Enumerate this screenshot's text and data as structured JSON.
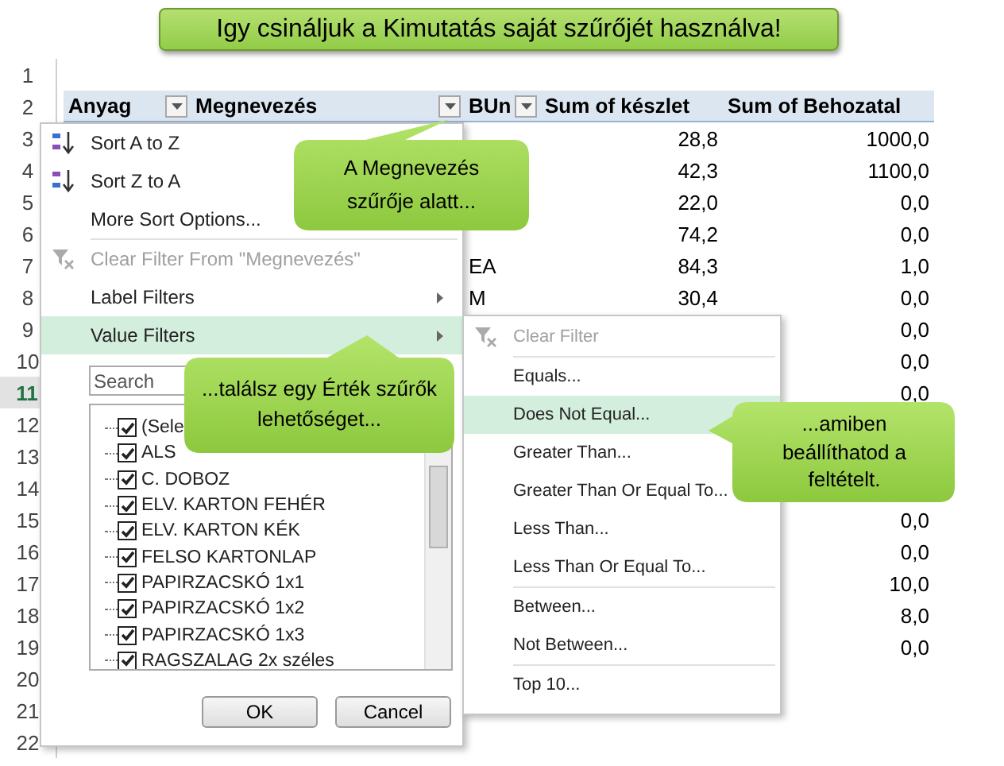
{
  "banner": {
    "text": "Igy csináljuk a Kimutatás saját szűrőjét használva!"
  },
  "sheet": {
    "row_numbers": [
      {
        "label": "1",
        "selected": false
      },
      {
        "label": "2",
        "selected": false
      },
      {
        "label": "3",
        "selected": false
      },
      {
        "label": "4",
        "selected": false
      },
      {
        "label": "5",
        "selected": false
      },
      {
        "label": "6",
        "selected": false
      },
      {
        "label": "7",
        "selected": false
      },
      {
        "label": "8",
        "selected": false
      },
      {
        "label": "9",
        "selected": false
      },
      {
        "label": "10",
        "selected": false
      },
      {
        "label": "11",
        "selected": true
      },
      {
        "label": "12",
        "selected": false
      },
      {
        "label": "13",
        "selected": false
      },
      {
        "label": "14",
        "selected": false
      },
      {
        "label": "15",
        "selected": false
      },
      {
        "label": "16",
        "selected": false
      },
      {
        "label": "17",
        "selected": false
      },
      {
        "label": "18",
        "selected": false
      },
      {
        "label": "19",
        "selected": false
      },
      {
        "label": "20",
        "selected": false
      },
      {
        "label": "21",
        "selected": false
      },
      {
        "label": "22",
        "selected": false
      }
    ],
    "columns": [
      {
        "label": "Anyag",
        "filter_button": true
      },
      {
        "label": "Megnevezés",
        "filter_button": true
      },
      {
        "label": "BUn",
        "filter_button": true
      },
      {
        "label": "Sum of készlet",
        "filter_button": false
      },
      {
        "label": "Sum of Behozatal",
        "filter_button": false
      }
    ],
    "rows": [
      {
        "keszlet": "28,8",
        "behozatal": "1000,0"
      },
      {
        "keszlet": "42,3",
        "behozatal": "1100,0"
      },
      {
        "keszlet": "22,0",
        "behozatal": "0,0"
      },
      {
        "keszlet": "74,2",
        "behozatal": "0,0"
      },
      {
        "bun": "EA",
        "keszlet": "84,3",
        "behozatal": "1,0"
      },
      {
        "bun": "M",
        "keszlet": "30,4",
        "behozatal": "0,0"
      },
      {
        "behozatal": "0,0"
      },
      {
        "behozatal": "0,0"
      },
      {
        "behozatal": "0,0"
      },
      {},
      {},
      {},
      {
        "behozatal": "0,0"
      },
      {
        "behozatal": "0,0"
      },
      {
        "behozatal": "10,0"
      },
      {
        "behozatal": "8,0"
      },
      {
        "behozatal": "0,0"
      }
    ]
  },
  "filter_menu": {
    "groups": [
      [
        {
          "kind": "sort_asc",
          "label": "Sort A to Z",
          "disabled": false,
          "selected": false
        },
        {
          "kind": "sort_desc",
          "label": "Sort Z to A",
          "disabled": false,
          "selected": false
        },
        {
          "kind": "item",
          "label": "More Sort Options...",
          "disabled": false,
          "selected": false
        }
      ],
      [
        {
          "kind": "clear",
          "label": "Clear Filter From \"Megnevezés\"",
          "disabled": true,
          "selected": false
        },
        {
          "kind": "submenu",
          "label": "Label Filters",
          "disabled": false,
          "selected": false
        },
        {
          "kind": "submenu",
          "label": "Value Filters",
          "disabled": false,
          "selected": true
        }
      ]
    ],
    "search": {
      "placeholder": "Search"
    },
    "checklist": [
      {
        "label": "(Sele",
        "checked": true
      },
      {
        "label": "ALS",
        "checked": true
      },
      {
        "label": "C. DOBOZ",
        "checked": true
      },
      {
        "label": "ELV. KARTON FEHÉR",
        "checked": true
      },
      {
        "label": "ELV. KARTON KÉK",
        "checked": true
      },
      {
        "label": "FELSO KARTONLAP",
        "checked": true
      },
      {
        "label": "PAPIRZACSKÓ 1x1",
        "checked": true
      },
      {
        "label": "PAPIRZACSKÓ 1x2",
        "checked": true
      },
      {
        "label": "PAPIRZACSKÓ 1x3",
        "checked": true
      },
      {
        "label": "RAGSZALAG 2x széles",
        "checked": true
      }
    ],
    "buttons": [
      "OK",
      "Cancel"
    ]
  },
  "value_filters_menu": {
    "groups": [
      [
        {
          "kind": "clear",
          "label": "Clear Filter",
          "disabled": true,
          "selected": false
        }
      ],
      [
        {
          "kind": "item",
          "label": "Equals...",
          "disabled": false,
          "selected": false
        },
        {
          "kind": "item",
          "label": "Does Not Equal...",
          "disabled": false,
          "selected": true
        },
        {
          "kind": "item",
          "label": "Greater Than...",
          "disabled": false,
          "selected": false
        },
        {
          "kind": "item",
          "label": "Greater Than Or Equal To...",
          "disabled": false,
          "selected": false
        },
        {
          "kind": "item",
          "label": "Less Than...",
          "disabled": false,
          "selected": false
        },
        {
          "kind": "item",
          "label": "Less Than Or Equal To...",
          "disabled": false,
          "selected": false
        }
      ],
      [
        {
          "kind": "item",
          "label": "Between...",
          "disabled": false,
          "selected": false
        },
        {
          "kind": "item",
          "label": "Not Between...",
          "disabled": false,
          "selected": false
        }
      ],
      [
        {
          "kind": "item",
          "label": "Top 10...",
          "disabled": false,
          "selected": false
        }
      ]
    ]
  },
  "callouts": [
    "A Megnevezés szűrője alatt...",
    "...találsz egy Érték szűrők lehetőséget...",
    "...amiben beállíthatod a feltételt."
  ]
}
